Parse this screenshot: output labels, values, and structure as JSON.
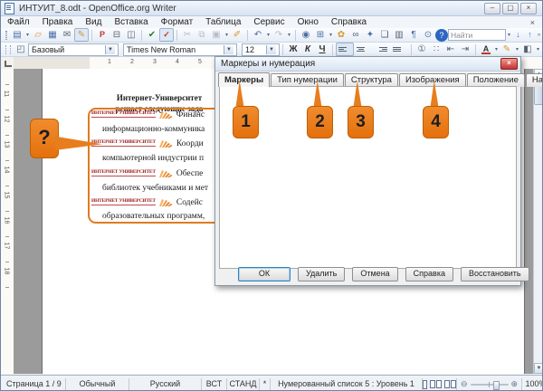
{
  "window": {
    "title": "ИНТУИТ_8.odt - OpenOffice.org Writer",
    "minimize": "‒",
    "maximize": "▢",
    "close": "×",
    "close_doc": "×"
  },
  "menubar": {
    "items": [
      "Файл",
      "Правка",
      "Вид",
      "Вставка",
      "Формат",
      "Таблица",
      "Сервис",
      "Окно",
      "Справка"
    ]
  },
  "toolbar_standard": {
    "icons": [
      {
        "name": "new-document",
        "glyph": "▤"
      },
      {
        "name": "open",
        "glyph": "▱"
      },
      {
        "name": "save",
        "glyph": "▦"
      },
      {
        "name": "document-as-email",
        "glyph": "✉"
      },
      {
        "name": "edit-file",
        "glyph": "✎"
      },
      {
        "name": "export-pdf",
        "glyph": "P"
      },
      {
        "name": "print",
        "glyph": "⊟"
      },
      {
        "name": "page-preview",
        "glyph": "◫"
      },
      {
        "name": "spellcheck",
        "glyph": "✔"
      },
      {
        "name": "auto-spellcheck",
        "glyph": "✓"
      },
      {
        "name": "cut",
        "glyph": "✂"
      },
      {
        "name": "copy",
        "glyph": "⧉"
      },
      {
        "name": "paste",
        "glyph": "▣"
      },
      {
        "name": "format-paintbrush",
        "glyph": "✐"
      },
      {
        "name": "undo",
        "glyph": "↶"
      },
      {
        "name": "redo",
        "glyph": "↷"
      },
      {
        "name": "hyperlink",
        "glyph": "◉"
      },
      {
        "name": "table",
        "glyph": "⊞"
      },
      {
        "name": "draw-functions",
        "glyph": "✿"
      },
      {
        "name": "find-replace",
        "glyph": "∞"
      },
      {
        "name": "navigator",
        "glyph": "✦"
      },
      {
        "name": "gallery",
        "glyph": "❏"
      },
      {
        "name": "data-sources",
        "glyph": "▥"
      },
      {
        "name": "nonprinting-characters",
        "glyph": "¶"
      },
      {
        "name": "zoom",
        "glyph": "⊙"
      },
      {
        "name": "help",
        "glyph": "?"
      }
    ],
    "find_placeholder": "Найти",
    "find_next": "↓",
    "find_prev": "↑",
    "overflow": "»"
  },
  "toolbar_formatting": {
    "styles_icon": "◰",
    "style_value": "Базовый",
    "font_value": "Times New Roman",
    "font_size": "12",
    "dropdown": "▼",
    "buttons": [
      {
        "name": "bold",
        "glyph": "Ж"
      },
      {
        "name": "italic",
        "glyph": "К"
      },
      {
        "name": "underline",
        "glyph": "Ч"
      },
      {
        "name": "numbered-list",
        "glyph": "①"
      },
      {
        "name": "bullet-list",
        "glyph": "∷"
      },
      {
        "name": "decrease-indent",
        "glyph": "⇤"
      },
      {
        "name": "increase-indent",
        "glyph": "⇥"
      },
      {
        "name": "font-color",
        "glyph": "А"
      },
      {
        "name": "highlighting",
        "glyph": "✎"
      },
      {
        "name": "background-color",
        "glyph": "◧"
      }
    ]
  },
  "ruler_h": {
    "numbers": [
      "1",
      "2",
      "3",
      "4",
      "5"
    ]
  },
  "ruler_v": {
    "numbers": [
      "11",
      "12",
      "13",
      "14",
      "15",
      "16",
      "17",
      "18"
    ]
  },
  "document": {
    "heading": [
      "Интернет-Университет",
      "решает следующие зада"
    ],
    "bullet_text": "ИНТЕРНЕТ УНИВЕРСИТЕТ",
    "items": [
      {
        "line1": "Финанс",
        "line2": "информационно-коммуника"
      },
      {
        "line1": "Коорди",
        "line2": "компьютерной индустрии п"
      },
      {
        "line1": "Обеспе",
        "line2": "библиотек учебниками и мет"
      },
      {
        "line1": "Содейс",
        "line2": "образовательных программ,"
      }
    ]
  },
  "callouts": {
    "question": "?",
    "labels": [
      "1",
      "2",
      "3",
      "4"
    ]
  },
  "dialog": {
    "title": "Маркеры и нумерация",
    "close": "×",
    "tabs": [
      {
        "label": "Маркеры",
        "active": true
      },
      {
        "label": "Тип нумерации"
      },
      {
        "label": "Структура"
      },
      {
        "label": "Изображения"
      },
      {
        "label": "Положение"
      },
      {
        "label": "Настройки"
      }
    ],
    "buttons": [
      "ОК",
      "Удалить",
      "Отмена",
      "Справка",
      "Восстановить"
    ]
  },
  "scrollbar": {
    "up": "▲",
    "down": "▼"
  },
  "statusbar": {
    "page": "Страница 1 / 9",
    "style": "Обычный",
    "language": "Русский",
    "insert_mode": "ВСТ",
    "selection_mode": "СТАНД",
    "modified": "*",
    "list_info": "Нумерованный список 5 : Уровень 1",
    "zoom_out": "⊖",
    "zoom_in": "⊕",
    "zoom_level": "100%"
  },
  "colors": {
    "callout_orange": "#ed7c1e",
    "callout_border": "#c05f00",
    "list_border_orange": "#e07b1f",
    "brand_red": "#991111",
    "dialog_close_red": "#c23434",
    "titlebar": "#dbe6f3",
    "workspace_gray": "#9b9b9b"
  }
}
